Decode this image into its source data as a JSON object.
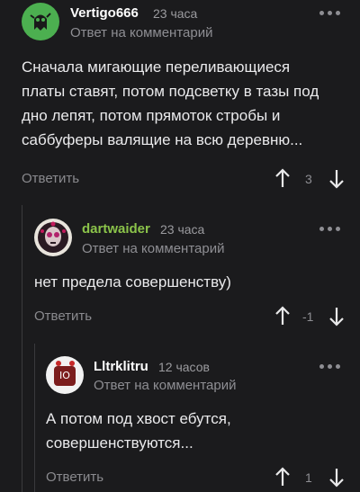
{
  "colors": {
    "background": "#1b1b1d",
    "username_white": "#ffffff",
    "username_green": "#8bc34a",
    "muted": "#8e8e93"
  },
  "comments": [
    {
      "username": "Vertigo666",
      "time": "23 часа",
      "reply_to": "Ответ на комментарий",
      "text_lines": [
        "Сначала мигающие переливающиеся",
        "платы ставят, потом подсветку в тазы под",
        "дно лепят, потом прямоток стробы и",
        "саббуферы валящие на всю деревню..."
      ],
      "reply_label": "Ответить",
      "score": "3",
      "avatar_icon": "ghost-avatar-icon"
    },
    {
      "username": "dartwaider",
      "time": "23 часа",
      "reply_to": "Ответ на комментарий",
      "text_lines": [
        "нет предела совершенству)"
      ],
      "reply_label": "Ответить",
      "score": "-1",
      "avatar_icon": "sugar-skull-avatar-icon"
    },
    {
      "username": "Lltrklitru",
      "time": "12 часов",
      "reply_to": "Ответ на комментарий",
      "text_lines": [
        "А потом под хвост ебутся,",
        "совершенствуются..."
      ],
      "reply_label": "Ответить",
      "score": "1",
      "avatar_icon": "sticker-avatar-icon"
    }
  ]
}
